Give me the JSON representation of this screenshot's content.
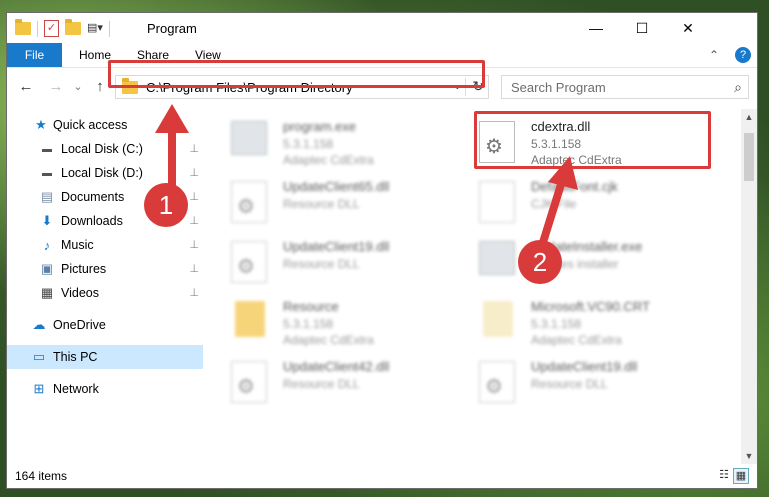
{
  "window": {
    "title": "Program",
    "minimize_glyph": "—",
    "maximize_glyph": "☐",
    "close_glyph": "✕"
  },
  "ribbon": {
    "tabs": [
      "File",
      "Home",
      "Share",
      "View"
    ],
    "help_glyph": "?",
    "collapse_glyph": "⌃"
  },
  "nav": {
    "back_glyph": "←",
    "forward_glyph": "→",
    "recent_glyph": "⌄",
    "up_glyph": "↑",
    "address": "C:\\Program Files\\Program Directory",
    "dropdown_glyph": "⌄",
    "refresh_glyph": "↻",
    "search_placeholder": "Search Program",
    "search_glyph": "⌕"
  },
  "sidebar": {
    "items": [
      {
        "label": "Quick access",
        "icon": "star-icon"
      },
      {
        "label": "Local Disk (C:)",
        "icon": "drive-icon",
        "pinned": true
      },
      {
        "label": "Local Disk (D:)",
        "icon": "drive-icon",
        "pinned": true
      },
      {
        "label": "Documents",
        "icon": "documents-icon",
        "pinned": true
      },
      {
        "label": "Downloads",
        "icon": "download-icon",
        "pinned": true
      },
      {
        "label": "Music",
        "icon": "music-icon",
        "pinned": true
      },
      {
        "label": "Pictures",
        "icon": "pictures-icon",
        "pinned": true
      },
      {
        "label": "Videos",
        "icon": "videos-icon",
        "pinned": true
      },
      {
        "label": "OneDrive",
        "icon": "cloud-icon"
      },
      {
        "label": "This PC",
        "icon": "computer-icon",
        "selected": true
      },
      {
        "label": "Network",
        "icon": "network-icon"
      }
    ],
    "pin_glyph": "📌"
  },
  "files": [
    {
      "name": "program.exe",
      "line2": "5.3.1.158",
      "line3": "Adaptec CdExtra",
      "icon": "exe-icon"
    },
    {
      "name": "cdextra.dll",
      "line2": "5.3.1.158",
      "line3": "Adaptec CdExtra",
      "icon": "dll-icon"
    },
    {
      "name": "UpdateClient65.dll",
      "line2": "Resource DLL",
      "line3": "",
      "icon": "dll-icon"
    },
    {
      "name": "DefaultFont.cjk",
      "line2": "CJK File",
      "line3": "",
      "icon": "file-icon"
    },
    {
      "name": "UpdateClient19.dll",
      "line2": "Resource DLL",
      "line3": "",
      "icon": "dll-icon"
    },
    {
      "name": "UpdateInstaller.exe",
      "line2": "updates installer",
      "line3": "",
      "icon": "exe-icon"
    },
    {
      "name": "Resource",
      "line2": "5.3.1.158",
      "line3": "Adaptec CdExtra",
      "icon": "folder-icon"
    },
    {
      "name": "Microsoft.VC90.CRT",
      "line2": "5.3.1.158",
      "line3": "Adaptec CdExtra",
      "icon": "folder-icon"
    },
    {
      "name": "UpdateClient42.dll",
      "line2": "Resource DLL",
      "line3": "",
      "icon": "dll-icon"
    },
    {
      "name": "UpdateClient19.dll",
      "line2": "Resource DLL",
      "line3": "",
      "icon": "dll-icon"
    }
  ],
  "status": {
    "item_count": "164 items"
  },
  "annotations": {
    "badge1": "1",
    "badge2": "2",
    "highlight_color": "#d93a3a"
  }
}
